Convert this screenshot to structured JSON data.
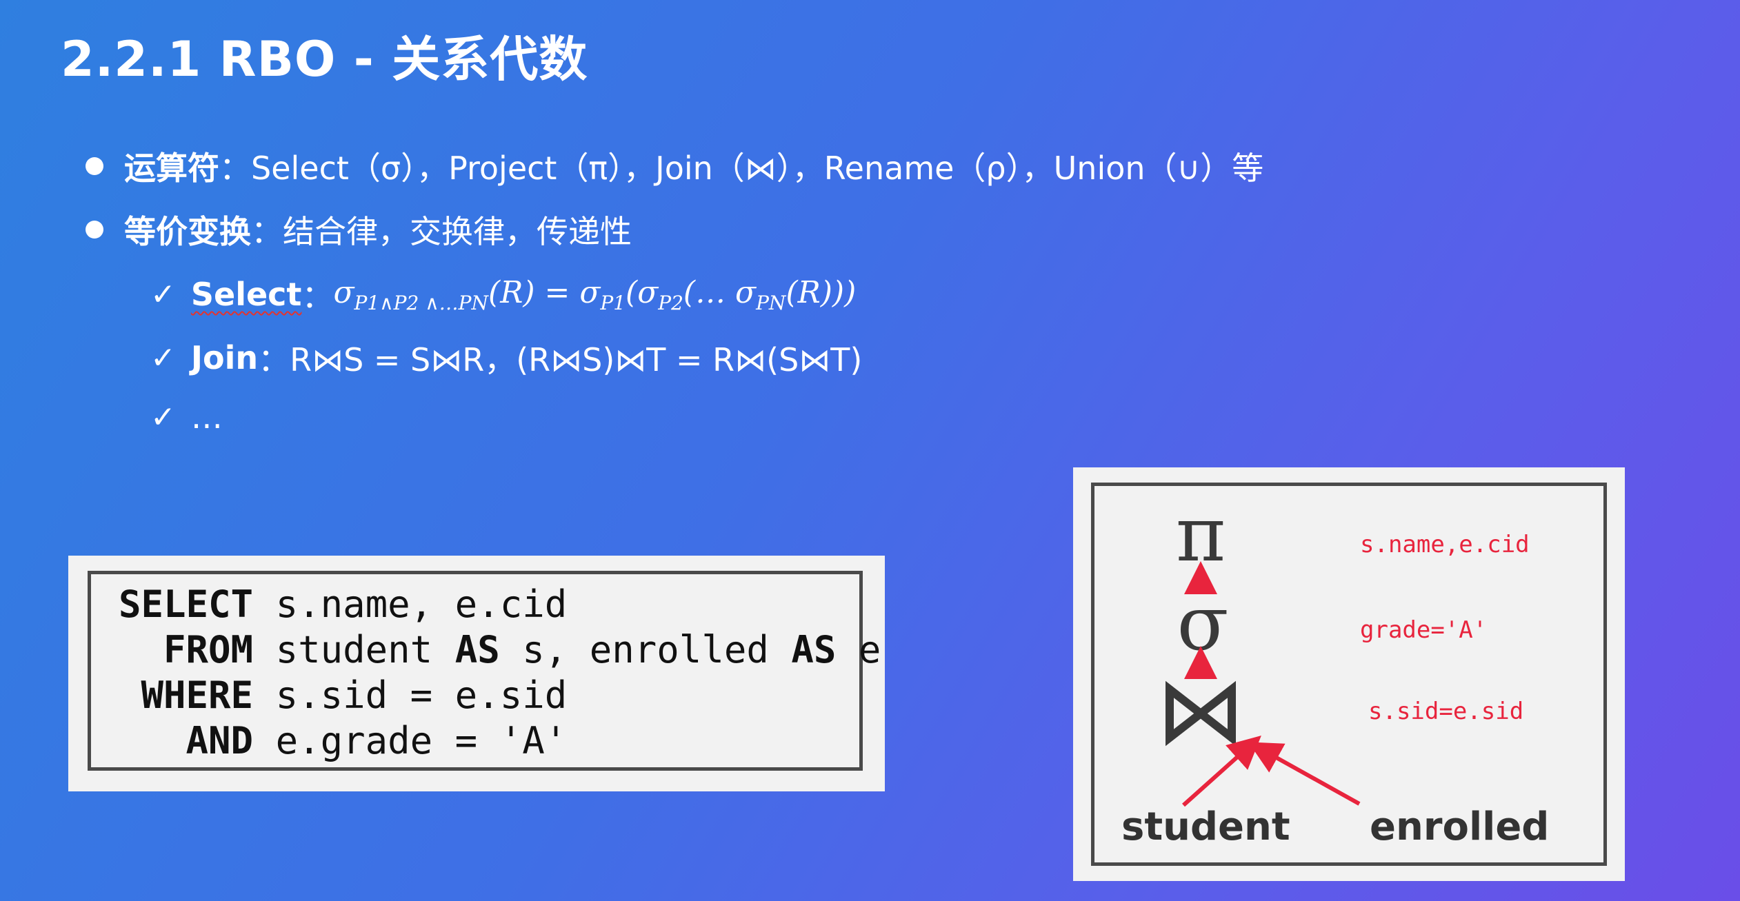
{
  "title": "2.2.1 RBO - 关系代数",
  "bullets": [
    {
      "label": "运算符",
      "text": "：Select（σ），Project（π），Join（⋈），Rename（ρ），Union（∪）等"
    },
    {
      "label": "等价变换",
      "text": "：结合律，交换律，传递性"
    }
  ],
  "checks": [
    {
      "label": "Select",
      "sep": "：",
      "formula": {
        "sigma": "σ",
        "sub_lhs": "P1∧P2 ∧…PN",
        "lhs_arg": "(R) = ",
        "sub_p1": "P1",
        "mid": "(σ",
        "sub_p2": "P2",
        "mid2": "(… σ",
        "sub_pn": "PN",
        "end": "(R)))"
      }
    },
    {
      "label": "Join",
      "text": "：R⋈S = S⋈R，(R⋈S)⋈T = R⋈(S⋈T)"
    },
    {
      "text": "…"
    }
  ],
  "sql": {
    "line1_kw": "SELECT",
    "line1_rest": " s.name, e.cid",
    "line2_kw": "  FROM",
    "line2_a": " student ",
    "line2_kw2": "AS",
    "line2_b": " s, enrolled ",
    "line2_kw3": "AS",
    "line2_c": " e",
    "line3_kw": " WHERE",
    "line3_rest": " s.sid = e.sid",
    "line4_kw": "   AND",
    "line4_rest": " e.grade = 'A'"
  },
  "tree": {
    "project_symbol": "π",
    "project_label": "s.name,e.cid",
    "select_symbol": "σ",
    "select_label": "grade='A'",
    "join_symbol": "⋈",
    "join_label": "s.sid=e.sid",
    "left_leaf": "student",
    "right_leaf": "enrolled",
    "arrow_color": "#e8243d"
  }
}
